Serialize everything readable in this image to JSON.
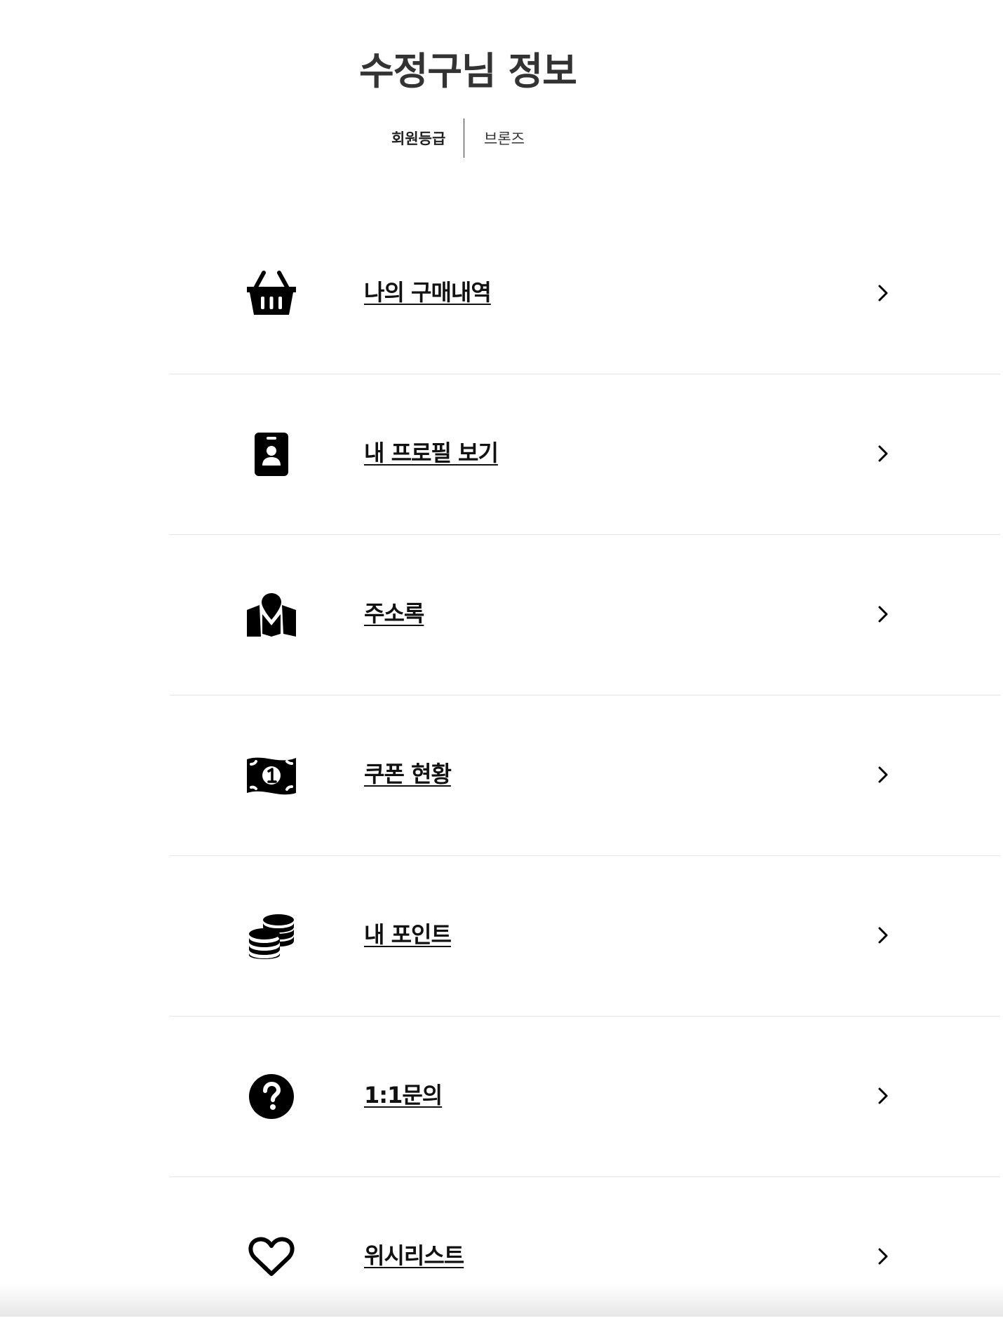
{
  "header": {
    "title": "수정구님 정보",
    "grade_label": "회원등급",
    "grade_value": "브론즈"
  },
  "menu": {
    "items": [
      {
        "label": "나의 구매내역",
        "icon": "shopping-basket-icon"
      },
      {
        "label": "내 프로필 보기",
        "icon": "id-badge-icon"
      },
      {
        "label": "주소록",
        "icon": "map-location-icon"
      },
      {
        "label": "쿠폰 현황",
        "icon": "money-bill-icon"
      },
      {
        "label": "내 포인트",
        "icon": "coins-icon"
      },
      {
        "label": "1:1문의",
        "icon": "question-circle-icon"
      },
      {
        "label": "위시리스트",
        "icon": "heart-outline-icon"
      }
    ],
    "chevron_icon": "chevron-right-icon"
  }
}
